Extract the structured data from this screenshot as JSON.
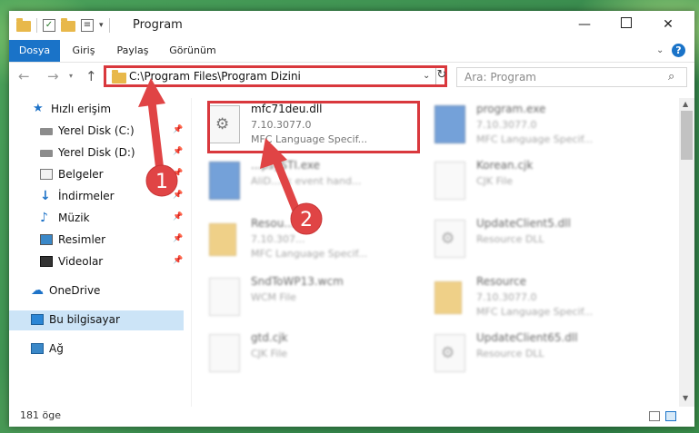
{
  "window": {
    "title": "Program",
    "controls": {
      "minimize": "—",
      "maximize": "",
      "close": "✕"
    }
  },
  "ribbon": {
    "tabs": [
      "Dosya",
      "Giriş",
      "Paylaş",
      "Görünüm"
    ],
    "help": "?"
  },
  "navigation": {
    "address": "C:\\Program Files\\Program Dizini",
    "search_placeholder": "Ara: Program"
  },
  "sidebar": {
    "items": [
      {
        "label": "Hızlı erişim",
        "icon": "star-icon",
        "pinned": false
      },
      {
        "label": "Yerel Disk (C:)",
        "icon": "drive-icon",
        "pinned": true
      },
      {
        "label": "Yerel Disk (D:)",
        "icon": "drive-icon",
        "pinned": true
      },
      {
        "label": "Belgeler",
        "icon": "documents-icon",
        "pinned": true
      },
      {
        "label": "İndirmeler",
        "icon": "download-icon",
        "pinned": true
      },
      {
        "label": "Müzik",
        "icon": "music-icon",
        "pinned": true
      },
      {
        "label": "Resimler",
        "icon": "pictures-icon",
        "pinned": true
      },
      {
        "label": "Videolar",
        "icon": "videos-icon",
        "pinned": true
      },
      {
        "label": "OneDrive",
        "icon": "cloud-icon",
        "pinned": false
      },
      {
        "label": "Bu bilgisayar",
        "icon": "computer-icon",
        "pinned": false,
        "selected": true
      },
      {
        "label": "Ağ",
        "icon": "network-icon",
        "pinned": false
      }
    ]
  },
  "files": [
    {
      "name": "mfc71deu.dll",
      "line2": "7.10.3077.0",
      "line3": "MFC Language Specif...",
      "icon": "dll-file-icon",
      "highlighted": true
    },
    {
      "name": "program.exe",
      "line2": "7.10.3077.0",
      "line3": "MFC Language Specif...",
      "icon": "exe-file-icon",
      "blurred": true
    },
    {
      "name": "...psySTI.exe",
      "line2": "AliD...ck event hand...",
      "line3": "",
      "icon": "exe-file-icon",
      "blurred": true
    },
    {
      "name": "Korean.cjk",
      "line2": "CJK File",
      "line3": "",
      "icon": "file-icon",
      "blurred": true
    },
    {
      "name": "Resou...",
      "line2": "7.10.307...",
      "line3": "MFC Language Specif...",
      "icon": "folder-icon",
      "blurred": true
    },
    {
      "name": "UpdateClient5.dll",
      "line2": "Resource DLL",
      "line3": "",
      "icon": "dll-file-icon",
      "blurred": true
    },
    {
      "name": "SndToWP13.wcm",
      "line2": "WCM File",
      "line3": "",
      "icon": "file-icon",
      "blurred": true
    },
    {
      "name": "Resource",
      "line2": "7.10.3077.0",
      "line3": "MFC Language Specif...",
      "icon": "folder-icon",
      "blurred": true
    },
    {
      "name": "gtd.cjk",
      "line2": "CJK File",
      "line3": "",
      "icon": "file-icon",
      "blurred": true
    },
    {
      "name": "UpdateClient65.dll",
      "line2": "Resource DLL",
      "line3": "",
      "icon": "dll-file-icon",
      "blurred": true
    }
  ],
  "status": {
    "count": "181 öge"
  },
  "annotations": [
    {
      "number": "1",
      "color": "#e04445"
    },
    {
      "number": "2",
      "color": "#e04445"
    }
  ]
}
